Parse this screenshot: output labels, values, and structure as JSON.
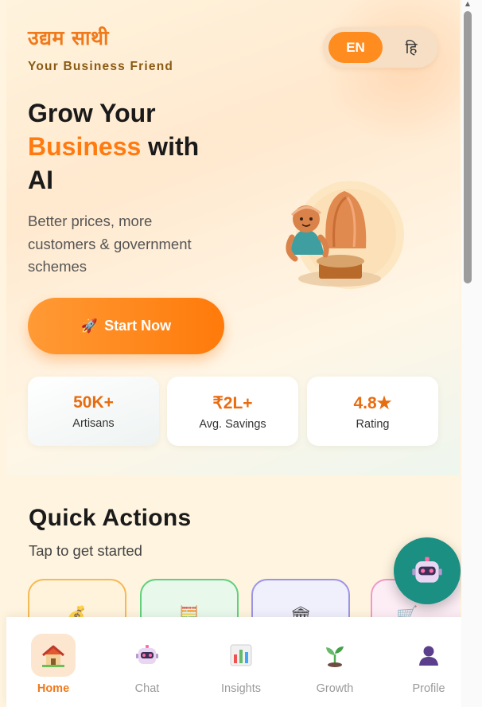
{
  "brand": {
    "name": "उद्यम साथी",
    "tagline": "Your Business Friend"
  },
  "language_toggle": {
    "english_label": "EN",
    "hindi_label": "हि",
    "selected": "EN"
  },
  "hero": {
    "headline_part1": "Grow Your",
    "headline_accent": "Business",
    "headline_part2": "with",
    "headline_part3": "AI",
    "subtext": "Better prices, more customers & government schemes",
    "cta_icon": "rocket-icon",
    "cta_label": "Start Now"
  },
  "stats": [
    {
      "value": "50K+",
      "label": "Artisans"
    },
    {
      "value": "₹2L+",
      "label": "Avg. Savings"
    },
    {
      "value": "4.8★",
      "label": "Rating"
    }
  ],
  "quick_actions": {
    "title": "Quick Actions",
    "subtitle": "Tap to get started",
    "cards": [
      {
        "icon": "money-bag-icon",
        "border_color": "#f5b955",
        "bg_color": "#fff3dc"
      },
      {
        "icon": "calculator-icon",
        "border_color": "#5fd07c",
        "bg_color": "#e8f9ec"
      },
      {
        "icon": "bank-icon",
        "border_color": "#9b95e8",
        "bg_color": "#f0effc"
      },
      {
        "icon": "shopping-cart-icon",
        "border_color": "#ef9ac8",
        "bg_color": "#fdeef5"
      }
    ]
  },
  "fab": {
    "icon": "robot-icon"
  },
  "bottom_nav": {
    "items": [
      {
        "label": "Home",
        "icon": "house-icon",
        "active": true
      },
      {
        "label": "Chat",
        "icon": "robot-icon",
        "active": false
      },
      {
        "label": "Insights",
        "icon": "bar-chart-icon",
        "active": false
      },
      {
        "label": "Growth",
        "icon": "seedling-icon",
        "active": false
      },
      {
        "label": "Profile",
        "icon": "person-icon",
        "active": false
      }
    ]
  },
  "colors": {
    "accent": "#ff7a0f",
    "brand": "#f0791a",
    "fab": "#1a8f82"
  }
}
